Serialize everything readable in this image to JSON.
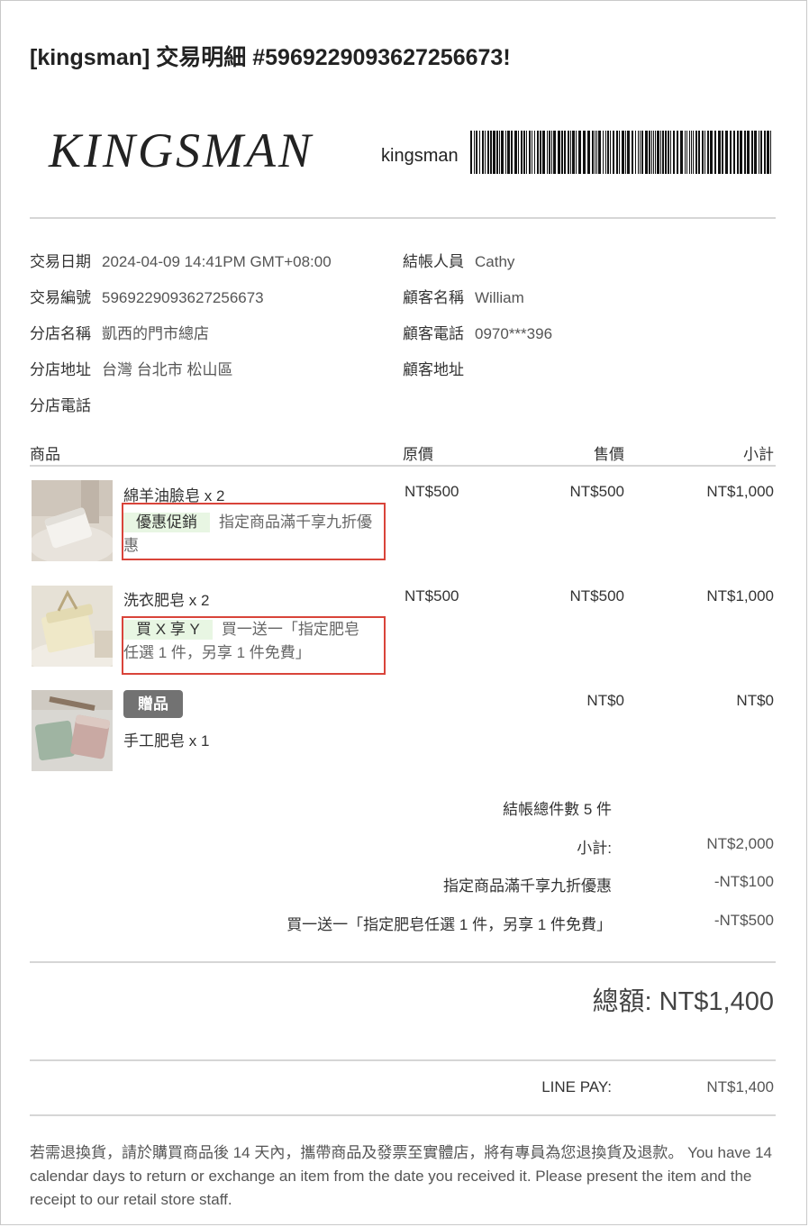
{
  "header": {
    "title": "[kingsman] 交易明細 #5969229093627256673!"
  },
  "brand": {
    "logo_text": "KINGSMAN",
    "shop_name": "kingsman"
  },
  "info": {
    "left": [
      {
        "label": "交易日期",
        "value": "2024-04-09 14:41PM GMT+08:00"
      },
      {
        "label": "交易編號",
        "value": "5969229093627256673"
      },
      {
        "label": "分店名稱",
        "value": "凱西的門市總店"
      },
      {
        "label": "分店地址",
        "value": "台灣 台北市 松山區"
      },
      {
        "label": "分店電話",
        "value": ""
      }
    ],
    "right": [
      {
        "label": "結帳人員",
        "value": "Cathy"
      },
      {
        "label": "顧客名稱",
        "value": "William"
      },
      {
        "label": "顧客電話",
        "value": "0970***396"
      },
      {
        "label": "顧客地址",
        "value": ""
      }
    ]
  },
  "table": {
    "headers": {
      "product": "商品",
      "original": "原價",
      "sale": "售價",
      "subtotal": "小計"
    },
    "items": [
      {
        "name": "綿羊油臉皂 x 2",
        "original": "NT$500",
        "sale": "NT$500",
        "subtotal": "NT$1,000",
        "promo_tag": "優惠促銷",
        "promo_text": "指定商品滿千享九折優惠"
      },
      {
        "name": "洗衣肥皂 x 2",
        "original": "NT$500",
        "sale": "NT$500",
        "subtotal": "NT$1,000",
        "promo_tag": "買 X 享 Y",
        "promo_text": "買一送一「指定肥皂任選 1 件，另享 1 件免費」"
      },
      {
        "name": "手工肥皂 x 1",
        "gift_tag": "贈品",
        "sale": "NT$0",
        "subtotal": "NT$0"
      }
    ]
  },
  "summary": {
    "count": "結帳總件數 5 件",
    "subtotal_label": "小計:",
    "subtotal_value": "NT$2,000",
    "discount1_label": "指定商品滿千享九折優惠",
    "discount1_value": "-NT$100",
    "discount2_label": "買一送一「指定肥皂任選 1 件，另享 1 件免費」",
    "discount2_value": "-NT$500",
    "total": "總額: NT$1,400",
    "payment_label": "LINE PAY:",
    "payment_value": "NT$1,400"
  },
  "footer": {
    "note": "若需退換貨，請於購買商品後 14 天內，攜帶商品及發票至實體店，將有專員為您退換貨及退款。 You have 14 calendar days to return or exchange an item from the date you received it. Please present the item and the receipt to our retail store staff."
  }
}
